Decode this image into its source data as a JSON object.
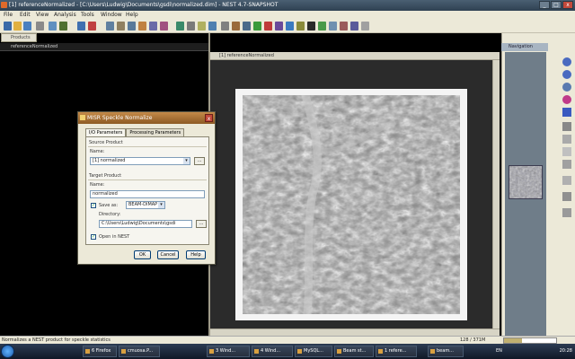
{
  "window": {
    "title": "[1] referenceNormalized - [C:\\Users\\Ludwig\\Documents\\gsdi\\normalized.dim] - NEST 4.7-SNAPSHOT",
    "min_label": "_",
    "max_label": "□",
    "close_label": "x"
  },
  "menu": [
    "File",
    "Edit",
    "View",
    "Analysis",
    "Tools",
    "Window",
    "Help"
  ],
  "left_panel": {
    "tab_label": "Products",
    "header_label": "referenceNormalized"
  },
  "image_view": {
    "header_label": "[1] referenceNormalized"
  },
  "right_panel": {
    "header_label": "Navigation"
  },
  "dialog": {
    "title": "MISR Speckle Normalize",
    "close_label": "x",
    "tabs": [
      "I/O Parameters",
      "Processing Parameters"
    ],
    "source_group": "Source Product",
    "source_name_label": "Name:",
    "source_value": "[1] normalized",
    "target_group": "Target Product",
    "target_name_label": "Name:",
    "target_value": "normalized",
    "save_as_label": "Save as:",
    "save_as_checked": true,
    "save_format": "BEAM-DIMAP",
    "directory_label": "Directory:",
    "directory_value": "C:\\Users\\Ludwig\\Documents\\gsdi",
    "open_in_label": "Open in NEST",
    "open_in_checked": true,
    "dots_label": "...",
    "ok_label": "OK",
    "cancel_label": "Cancel",
    "help_label": "Help",
    "check_mark": "✓"
  },
  "status": {
    "message": "Normalizes a NEST product for speckle statistics",
    "memory": "128 / 371M"
  },
  "taskbar": {
    "tasks": [
      "6 Firefox",
      "cmuosa.P...",
      "3 Wind...",
      "4 Wind...",
      "MySQL...",
      "Beam st...",
      "1 refere...",
      "beam..."
    ],
    "clock": "20:28",
    "lang": "EN"
  },
  "colors": {
    "dialog_title": "#a87038",
    "accent_blue": "#1c5aa8"
  }
}
